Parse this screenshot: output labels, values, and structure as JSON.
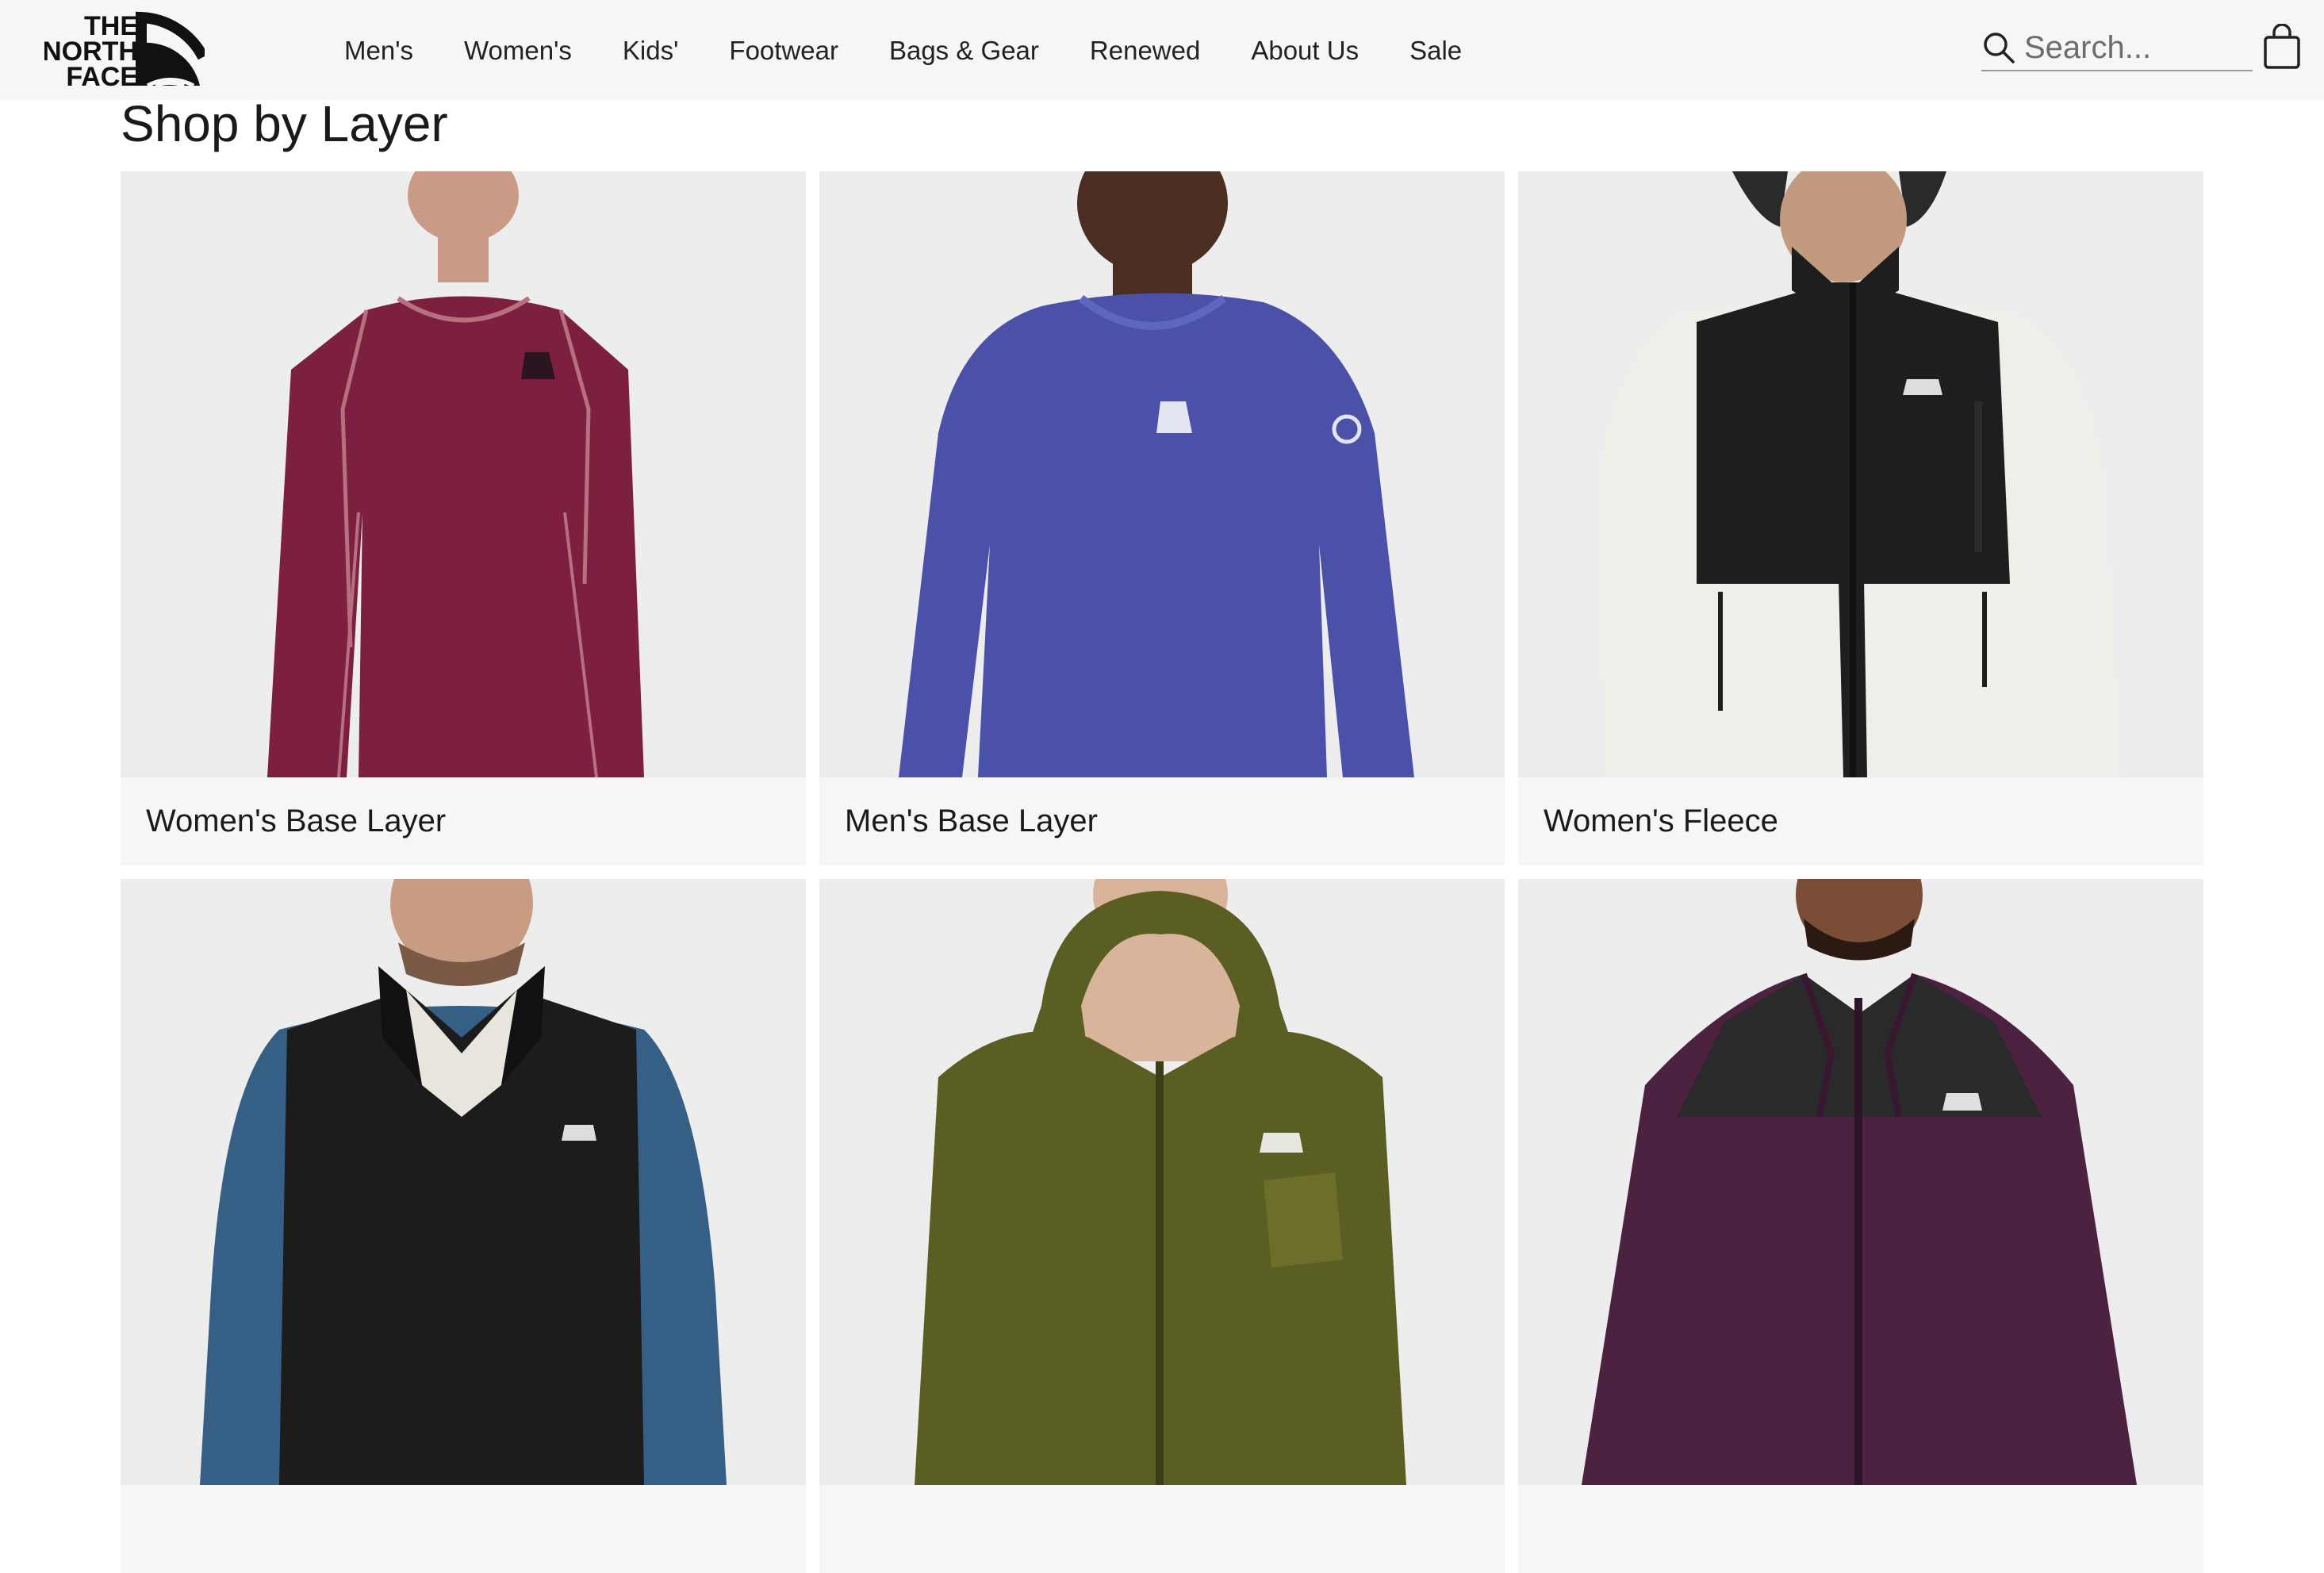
{
  "brand": {
    "logo_text": "THE NORTH FACE"
  },
  "nav": {
    "items": [
      "Men's",
      "Women's",
      "Kids'",
      "Footwear",
      "Bags & Gear",
      "Renewed",
      "About Us",
      "Sale"
    ]
  },
  "search": {
    "placeholder": "Search...",
    "value": ""
  },
  "section": {
    "title": "Shop by Layer"
  },
  "cards": [
    {
      "label": "Women's Base Layer",
      "color": "#7d1f3f",
      "accent": "#b7707f",
      "icon": "base-layer-shirt"
    },
    {
      "label": "Men's Base Layer",
      "color": "#4b51a8",
      "accent": "#5f66c0",
      "icon": "base-layer-shirt"
    },
    {
      "label": "Women's Fleece",
      "color": "#1e1e1e",
      "accent": "#efeee9",
      "icon": "fleece-jacket"
    },
    {
      "label": "",
      "color": "#1c1c1c",
      "accent": "#365f86",
      "icon": "fleece-jacket"
    },
    {
      "label": "",
      "color": "#5a5e22",
      "accent": "#6b6f2a",
      "icon": "rain-jacket"
    },
    {
      "label": "",
      "color": "#4d2240",
      "accent": "#2a2a2a",
      "icon": "insulated-jacket"
    }
  ],
  "colors": {
    "header_bg": "#f6f6f6",
    "card_bg": "#f6f6f6",
    "image_bg": "#ededed"
  }
}
